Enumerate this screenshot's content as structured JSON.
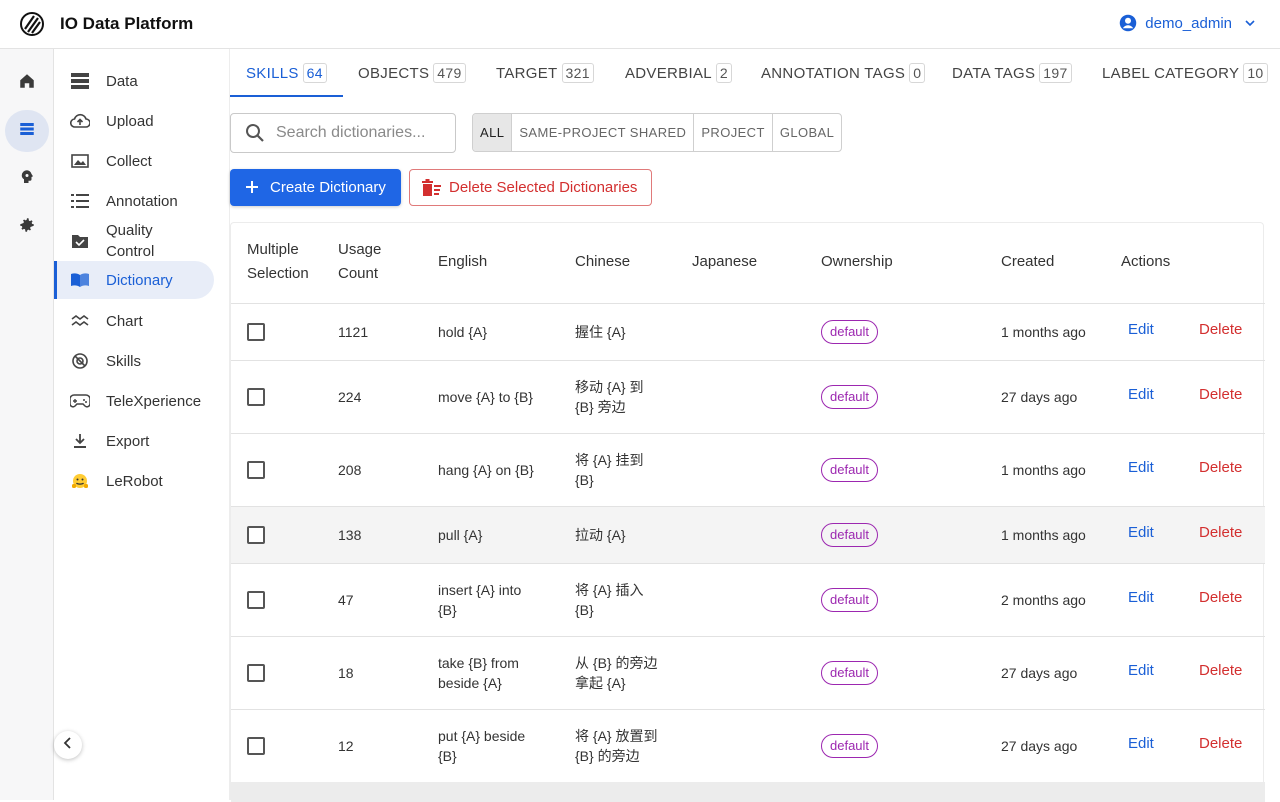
{
  "app": {
    "title": "IO Data Platform"
  },
  "user": {
    "name": "demo_admin"
  },
  "sidebar": {
    "items": [
      {
        "label": "Data",
        "icon": "data-icon"
      },
      {
        "label": "Upload",
        "icon": "cloud-upload-icon"
      },
      {
        "label": "Collect",
        "icon": "collect-icon"
      },
      {
        "label": "Annotation",
        "icon": "list-icon"
      },
      {
        "label": "Quality\nControl",
        "icon": "quality-icon"
      },
      {
        "label": "Dictionary",
        "icon": "book-icon",
        "active": true
      },
      {
        "label": "Chart",
        "icon": "chart-icon"
      },
      {
        "label": "Skills",
        "icon": "skills-icon"
      },
      {
        "label": "TeleXperience",
        "icon": "gamepad-icon"
      },
      {
        "label": "Export",
        "icon": "download-icon"
      },
      {
        "label": "LeRobot",
        "icon": "hugging-face-icon"
      }
    ]
  },
  "tabs": [
    {
      "label": "SKILLS",
      "count": "64",
      "active": true
    },
    {
      "label": "OBJECTS",
      "count": "479"
    },
    {
      "label": "TARGET",
      "count": "321"
    },
    {
      "label": "ADVERBIAL",
      "count": "2"
    },
    {
      "label": "ANNOTATION TAGS",
      "count": "0"
    },
    {
      "label": "DATA TAGS",
      "count": "197"
    },
    {
      "label": "LABEL CATEGORY",
      "count": "10"
    }
  ],
  "search": {
    "placeholder": "Search dictionaries..."
  },
  "filters": [
    {
      "label": "ALL",
      "active": true
    },
    {
      "label": "SAME-PROJECT SHARED"
    },
    {
      "label": "PROJECT"
    },
    {
      "label": "GLOBAL"
    }
  ],
  "actions": {
    "create_label": "Create Dictionary",
    "delete_label": "Delete Selected Dictionaries"
  },
  "table": {
    "headers": {
      "select": "Multiple\nSelection",
      "usage": "Usage\nCount",
      "english": "English",
      "chinese": "Chinese",
      "japanese": "Japanese",
      "ownership": "Ownership",
      "created": "Created",
      "actions": "Actions"
    },
    "edit_label": "Edit",
    "delete_label": "Delete",
    "rows": [
      {
        "usage": "1121",
        "english": "hold {A}",
        "chinese": "握住 {A}",
        "japanese": "",
        "ownership": "default",
        "created": "1 months ago"
      },
      {
        "usage": "224",
        "english": "move {A} to {B}",
        "chinese": "移动 {A} 到\n{B} 旁边",
        "japanese": "",
        "ownership": "default",
        "created": "27 days ago"
      },
      {
        "usage": "208",
        "english": "hang {A} on {B}",
        "chinese": "将 {A} 挂到\n{B}",
        "japanese": "",
        "ownership": "default",
        "created": "1 months ago"
      },
      {
        "usage": "138",
        "english": "pull {A}",
        "chinese": "拉动 {A}",
        "japanese": "",
        "ownership": "default",
        "created": "1 months ago"
      },
      {
        "usage": "47",
        "english": "insert {A} into\n{B}",
        "chinese": "将 {A} 插入\n{B}",
        "japanese": "",
        "ownership": "default",
        "created": "2 months ago"
      },
      {
        "usage": "18",
        "english": "take {B} from\nbeside {A}",
        "chinese": "从 {B} 的旁边\n拿起 {A}",
        "japanese": "",
        "ownership": "default",
        "created": "27 days ago"
      },
      {
        "usage": "12",
        "english": "put {A} beside\n{B}",
        "chinese": "将 {A} 放置到\n{B} 的旁边",
        "japanese": "",
        "ownership": "default",
        "created": "27 days ago"
      }
    ]
  },
  "colors": {
    "primary": "#1f66e5",
    "danger": "#d32f2f",
    "ownership_badge": "#9c27b0"
  }
}
